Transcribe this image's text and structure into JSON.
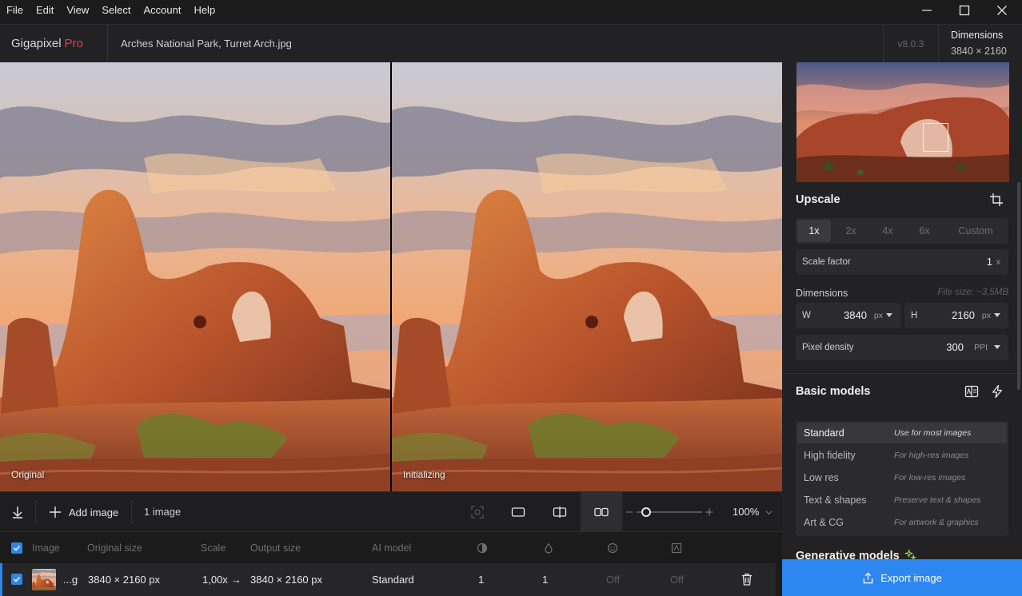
{
  "menu": [
    "File",
    "Edit",
    "View",
    "Select",
    "Account",
    "Help"
  ],
  "app": {
    "name": "Gigapixel",
    "edition": "Pro",
    "filename": "Arches National Park, Turret Arch.jpg",
    "version": "v8.0.3"
  },
  "header_dims": {
    "label": "Dimensions",
    "value": "3840 × 2160"
  },
  "preview": {
    "left_label": "Original",
    "right_label": "Initializing"
  },
  "toolbar": {
    "add_image": "Add image",
    "image_count": "1 image",
    "zoom": "100%",
    "zoom_level": 0.15
  },
  "table": {
    "headers": [
      "Image",
      "Original size",
      "Scale",
      "Output size",
      "AI model"
    ],
    "row": {
      "name": "...g",
      "original": "3840 × 2160 px",
      "scale": "1,00x",
      "arrow": "→",
      "output": "3840 × 2160 px",
      "model": "Standard",
      "val1": "1",
      "val2": "1",
      "off1": "Off",
      "off2": "Off"
    }
  },
  "upscale": {
    "title": "Upscale",
    "options": [
      "1x",
      "2x",
      "4x",
      "6x",
      "Custom"
    ],
    "selected": "1x",
    "scale_factor_label": "Scale factor",
    "scale_factor_value": "1",
    "scale_factor_unit": "x",
    "dimensions_label": "Dimensions",
    "file_size": "File size: ~3,5MB",
    "width_label": "W",
    "width_value": "3840",
    "width_unit": "px",
    "height_label": "H",
    "height_value": "2160",
    "height_unit": "px",
    "density_label": "Pixel density",
    "density_value": "300",
    "density_unit": "PPI"
  },
  "basic_models": {
    "title": "Basic models",
    "items": [
      {
        "name": "Standard",
        "desc": "Use for most images",
        "active": true
      },
      {
        "name": "High fidelity",
        "desc": "For high-res images"
      },
      {
        "name": "Low res",
        "desc": "For low-res images"
      },
      {
        "name": "Text & shapes",
        "desc": "Preserve text & shapes"
      },
      {
        "name": "Art & CG",
        "desc": "For artwork & graphics"
      }
    ]
  },
  "generative_models": {
    "title": "Generative models"
  },
  "export": {
    "label": "Export image"
  },
  "colors": {
    "accent": "#2e86f0",
    "pro": "#e8375a"
  }
}
